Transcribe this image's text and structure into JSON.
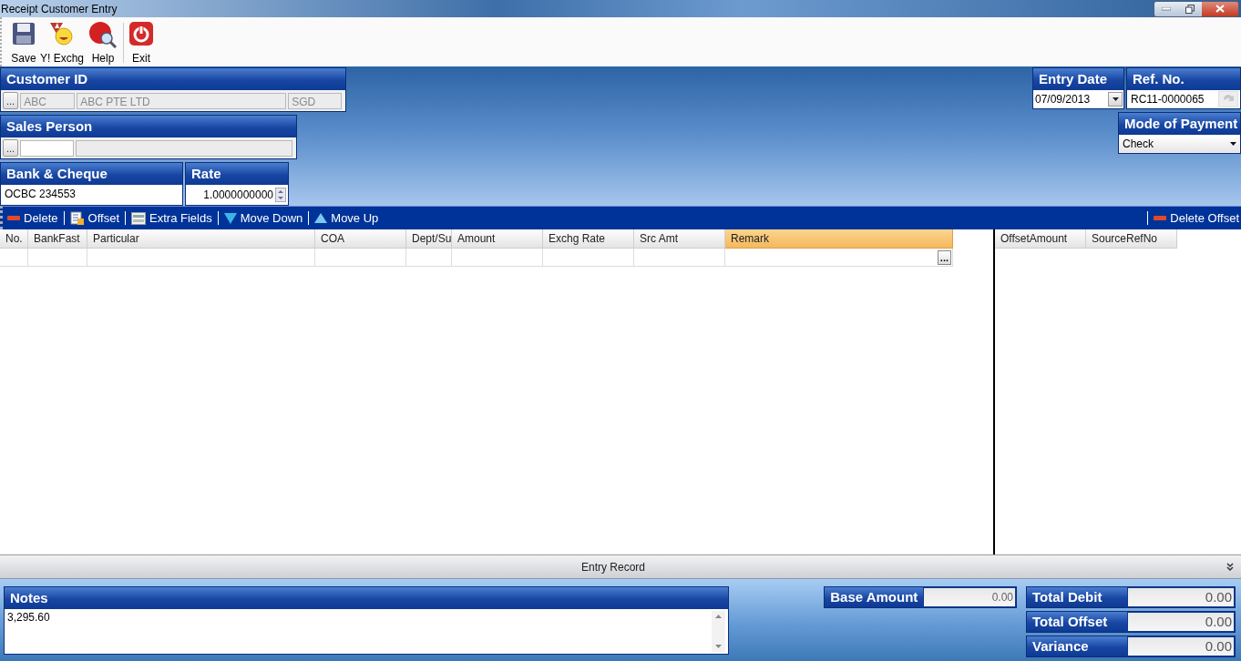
{
  "window": {
    "title": "Receipt Customer Entry"
  },
  "toolbar": [
    {
      "label": "Save",
      "kind": "save"
    },
    {
      "label": "Y! Exchg",
      "kind": "exchange"
    },
    {
      "label": "Help",
      "kind": "help"
    },
    {
      "label": "Exit",
      "kind": "exit"
    }
  ],
  "customer": {
    "label": "Customer ID",
    "lookup": "...",
    "code": "ABC",
    "name": "ABC PTE LTD",
    "currency": "SGD"
  },
  "sales_person": {
    "label": "Sales Person",
    "lookup": "..."
  },
  "bank_cheque": {
    "label": "Bank & Cheque",
    "value": "OCBC 234553"
  },
  "rate": {
    "label": "Rate",
    "value": "1.0000000000"
  },
  "entry_date": {
    "label": "Entry Date",
    "value": "07/09/2013"
  },
  "ref_no": {
    "label": "Ref. No.",
    "value": "RC11-0000065"
  },
  "mode_of_payment": {
    "label": "Mode of Payment",
    "value": "Check"
  },
  "grid_toolbar": {
    "left": [
      {
        "label": "Delete",
        "kind": "delete"
      },
      {
        "label": "Offset",
        "kind": "offset"
      },
      {
        "label": "Extra Fields",
        "kind": "fields"
      },
      {
        "label": "Move Down",
        "kind": "down"
      },
      {
        "label": "Move Up",
        "kind": "up"
      }
    ],
    "right": [
      {
        "label": "Delete Offset",
        "kind": "delete"
      }
    ]
  },
  "entries_table": {
    "columns": [
      {
        "label": "No.",
        "selected": false
      },
      {
        "label": "BankFast",
        "selected": false
      },
      {
        "label": "Particular",
        "selected": false
      },
      {
        "label": "COA",
        "selected": false
      },
      {
        "label": "Dept/Su",
        "selected": false
      },
      {
        "label": "Amount",
        "selected": false
      },
      {
        "label": "Exchg Rate",
        "selected": false
      },
      {
        "label": "Src Amt",
        "selected": false
      },
      {
        "label": "Remark",
        "selected": true
      }
    ],
    "new_row": {
      "button": "..."
    }
  },
  "offset_table": {
    "columns": [
      "OffsetAmount",
      "SourceRefNo"
    ]
  },
  "entry_record": {
    "label": "Entry Record"
  },
  "notes": {
    "label": "Notes",
    "value": "3,295.60"
  },
  "base_amount": {
    "label": "Base Amount",
    "value": "0.00"
  },
  "totals": [
    {
      "label": "Total Debit",
      "value": "0.00"
    },
    {
      "label": "Total Offset",
      "value": "0.00"
    },
    {
      "label": "Variance",
      "value": "0.00"
    }
  ]
}
